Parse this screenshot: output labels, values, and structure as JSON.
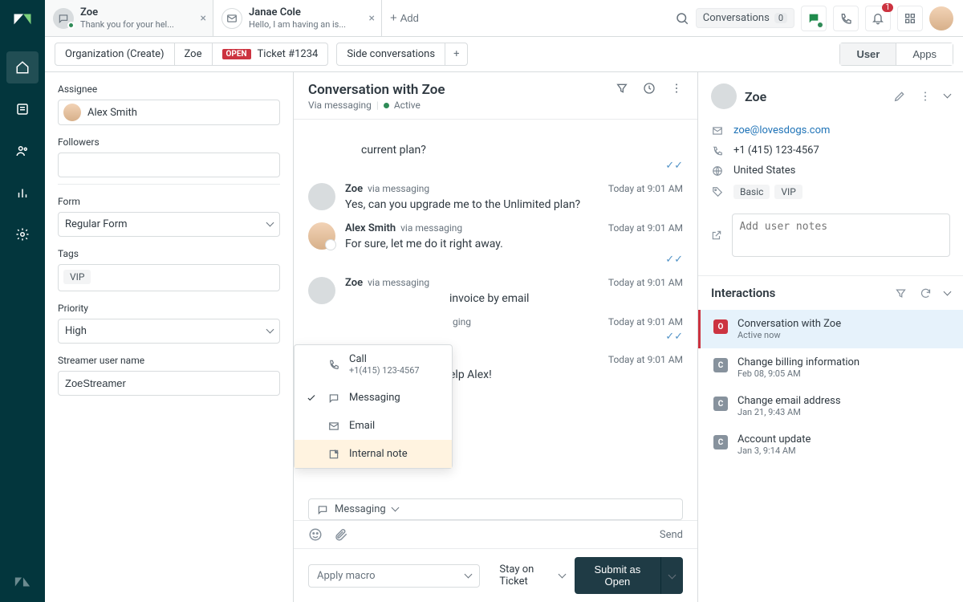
{
  "tabs": [
    {
      "title": "Zoe",
      "sub": "Thank you for your hel...",
      "icon": "messaging-icon",
      "active": true
    },
    {
      "title": "Janae Cole",
      "sub": "Hello, I am having an is...",
      "icon": "email-icon",
      "active": false
    }
  ],
  "add_tab_label": "Add",
  "top_actions": {
    "conversations_label": "Conversations",
    "conversations_count": "0",
    "notifications_count": "1"
  },
  "breadcrumb": {
    "org": "Organization (Create)",
    "user": "Zoe",
    "status": "OPEN",
    "ticket": "Ticket #1234"
  },
  "side_conversations_label": "Side conversations",
  "right_tabs": {
    "user": "User",
    "apps": "Apps",
    "active": "user"
  },
  "form": {
    "assignee_label": "Assignee",
    "assignee_value": "Alex Smith",
    "followers_label": "Followers",
    "followers_value": "",
    "form_label": "Form",
    "form_value": "Regular Form",
    "tags_label": "Tags",
    "tags": [
      "VIP"
    ],
    "priority_label": "Priority",
    "priority_value": "High",
    "streamer_label": "Streamer user name",
    "streamer_value": "ZoeStreamer"
  },
  "conversation": {
    "title": "Conversation with Zoe",
    "via": "Via messaging",
    "status": "Active",
    "messages": [
      {
        "author": "",
        "via": "",
        "time": "",
        "text": "current plan?",
        "delivered": true,
        "frag": true
      },
      {
        "author": "Zoe",
        "via": "via messaging",
        "time": "Today at 9:01 AM",
        "text": "Yes, can you upgrade me to the Unlimited plan?"
      },
      {
        "author": "Alex Smith",
        "via": "via messaging",
        "time": "Today at 9:01 AM",
        "text": "For sure, let me do it right away.",
        "agent": true,
        "delivered": true
      },
      {
        "author": "Zoe",
        "via": "via messaging",
        "time": "Today at 9:01 AM",
        "text": "invoice by email"
      },
      {
        "author": "",
        "via": "ging",
        "time": "Today at 9:01 AM",
        "text": "",
        "delivered": true,
        "frag": true
      },
      {
        "author": "",
        "via": "",
        "time": "Today at 9:01 AM",
        "text": "elp Alex!",
        "frag": true
      }
    ],
    "reply_menu": {
      "call": "Call",
      "call_sub": "+1(415) 123-4567",
      "messaging": "Messaging",
      "email": "Email",
      "internal_note": "Internal note",
      "selected": "messaging"
    },
    "channel_chip": "Messaging",
    "send_label": "Send",
    "macro_label": "Apply macro",
    "stay_label": "Stay on Ticket",
    "submit_label": "Submit as Open"
  },
  "context": {
    "name": "Zoe",
    "email": "zoe@lovesdogs.com",
    "phone": "+1 (415) 123-4567",
    "location": "United States",
    "tags": [
      "Basic",
      "VIP"
    ],
    "notes_placeholder": "Add user notes"
  },
  "interactions": {
    "title": "Interactions",
    "items": [
      {
        "badge": "O",
        "title": "Conversation with Zoe",
        "ts": "Active now",
        "active": true
      },
      {
        "badge": "C",
        "title": "Change billing information",
        "ts": "Feb 08, 9:05 AM"
      },
      {
        "badge": "C",
        "title": "Change email address",
        "ts": "Jan 21, 9:43 AM"
      },
      {
        "badge": "C",
        "title": "Account update",
        "ts": "Jan 3, 9:14 AM"
      }
    ]
  }
}
